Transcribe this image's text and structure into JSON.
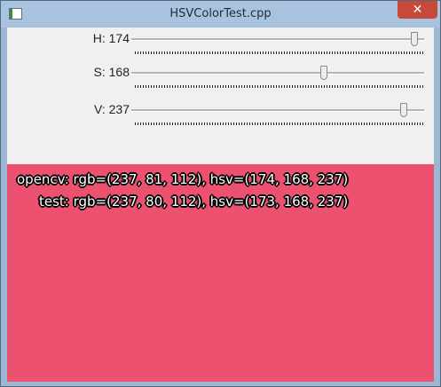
{
  "window": {
    "title": "HSVColorTest.cpp",
    "close_glyph": "✕"
  },
  "trackbars": [
    {
      "label": "H: 174",
      "value": 174,
      "max": 180
    },
    {
      "label": "S: 168",
      "value": 168,
      "max": 255
    },
    {
      "label": "V: 237",
      "value": 237,
      "max": 255
    }
  ],
  "display": {
    "color": "#ed5170",
    "lines": [
      "opencv: rgb=(237, 81, 112), hsv=(174, 168, 237)",
      "test: rgb=(237, 80, 112), hsv=(173, 168, 237)"
    ]
  }
}
